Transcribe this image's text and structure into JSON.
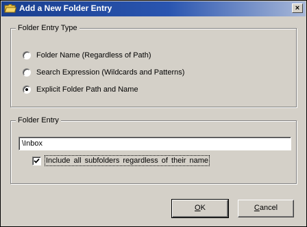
{
  "window": {
    "title": "Add a New Folder Entry",
    "close_label": "×"
  },
  "type_group": {
    "legend": "Folder Entry Type",
    "options": [
      {
        "label": "Folder Name (Regardless of Path)",
        "checked": false
      },
      {
        "label": "Search Expression (Wildcards and Patterns)",
        "checked": false
      },
      {
        "label": "Explicit Folder Path and Name",
        "checked": true
      }
    ]
  },
  "entry_group": {
    "legend": "Folder Entry",
    "value": "\\Inbox",
    "include_subfolders": {
      "label": "Include all subfolders regardless of their name",
      "checked": true
    }
  },
  "buttons": {
    "ok": {
      "mnemonic": "O",
      "rest": "K"
    },
    "cancel": {
      "mnemonic": "C",
      "rest": "ancel"
    }
  },
  "icons": {
    "title": "folder-icon",
    "check": "checkmark-icon"
  },
  "colors": {
    "face": "#d4d0c8",
    "titlebar_start": "#1a3f8f",
    "titlebar_end": "#a8b8d8"
  }
}
